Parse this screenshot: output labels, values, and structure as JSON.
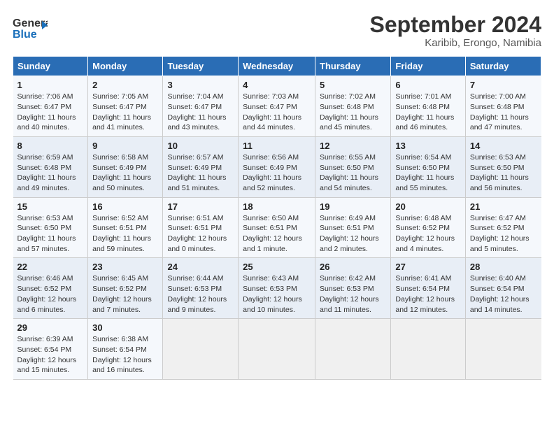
{
  "logo": {
    "line1": "General",
    "line2": "Blue",
    "icon": "▶"
  },
  "title": "September 2024",
  "subtitle": "Karibib, Erongo, Namibia",
  "days_of_week": [
    "Sunday",
    "Monday",
    "Tuesday",
    "Wednesday",
    "Thursday",
    "Friday",
    "Saturday"
  ],
  "weeks": [
    [
      {
        "day": "1",
        "info": "Sunrise: 7:06 AM\nSunset: 6:47 PM\nDaylight: 11 hours\nand 40 minutes."
      },
      {
        "day": "2",
        "info": "Sunrise: 7:05 AM\nSunset: 6:47 PM\nDaylight: 11 hours\nand 41 minutes."
      },
      {
        "day": "3",
        "info": "Sunrise: 7:04 AM\nSunset: 6:47 PM\nDaylight: 11 hours\nand 43 minutes."
      },
      {
        "day": "4",
        "info": "Sunrise: 7:03 AM\nSunset: 6:47 PM\nDaylight: 11 hours\nand 44 minutes."
      },
      {
        "day": "5",
        "info": "Sunrise: 7:02 AM\nSunset: 6:48 PM\nDaylight: 11 hours\nand 45 minutes."
      },
      {
        "day": "6",
        "info": "Sunrise: 7:01 AM\nSunset: 6:48 PM\nDaylight: 11 hours\nand 46 minutes."
      },
      {
        "day": "7",
        "info": "Sunrise: 7:00 AM\nSunset: 6:48 PM\nDaylight: 11 hours\nand 47 minutes."
      }
    ],
    [
      {
        "day": "8",
        "info": "Sunrise: 6:59 AM\nSunset: 6:48 PM\nDaylight: 11 hours\nand 49 minutes."
      },
      {
        "day": "9",
        "info": "Sunrise: 6:58 AM\nSunset: 6:49 PM\nDaylight: 11 hours\nand 50 minutes."
      },
      {
        "day": "10",
        "info": "Sunrise: 6:57 AM\nSunset: 6:49 PM\nDaylight: 11 hours\nand 51 minutes."
      },
      {
        "day": "11",
        "info": "Sunrise: 6:56 AM\nSunset: 6:49 PM\nDaylight: 11 hours\nand 52 minutes."
      },
      {
        "day": "12",
        "info": "Sunrise: 6:55 AM\nSunset: 6:50 PM\nDaylight: 11 hours\nand 54 minutes."
      },
      {
        "day": "13",
        "info": "Sunrise: 6:54 AM\nSunset: 6:50 PM\nDaylight: 11 hours\nand 55 minutes."
      },
      {
        "day": "14",
        "info": "Sunrise: 6:53 AM\nSunset: 6:50 PM\nDaylight: 11 hours\nand 56 minutes."
      }
    ],
    [
      {
        "day": "15",
        "info": "Sunrise: 6:53 AM\nSunset: 6:50 PM\nDaylight: 11 hours\nand 57 minutes."
      },
      {
        "day": "16",
        "info": "Sunrise: 6:52 AM\nSunset: 6:51 PM\nDaylight: 11 hours\nand 59 minutes."
      },
      {
        "day": "17",
        "info": "Sunrise: 6:51 AM\nSunset: 6:51 PM\nDaylight: 12 hours\nand 0 minutes."
      },
      {
        "day": "18",
        "info": "Sunrise: 6:50 AM\nSunset: 6:51 PM\nDaylight: 12 hours\nand 1 minute."
      },
      {
        "day": "19",
        "info": "Sunrise: 6:49 AM\nSunset: 6:51 PM\nDaylight: 12 hours\nand 2 minutes."
      },
      {
        "day": "20",
        "info": "Sunrise: 6:48 AM\nSunset: 6:52 PM\nDaylight: 12 hours\nand 4 minutes."
      },
      {
        "day": "21",
        "info": "Sunrise: 6:47 AM\nSunset: 6:52 PM\nDaylight: 12 hours\nand 5 minutes."
      }
    ],
    [
      {
        "day": "22",
        "info": "Sunrise: 6:46 AM\nSunset: 6:52 PM\nDaylight: 12 hours\nand 6 minutes."
      },
      {
        "day": "23",
        "info": "Sunrise: 6:45 AM\nSunset: 6:52 PM\nDaylight: 12 hours\nand 7 minutes."
      },
      {
        "day": "24",
        "info": "Sunrise: 6:44 AM\nSunset: 6:53 PM\nDaylight: 12 hours\nand 9 minutes."
      },
      {
        "day": "25",
        "info": "Sunrise: 6:43 AM\nSunset: 6:53 PM\nDaylight: 12 hours\nand 10 minutes."
      },
      {
        "day": "26",
        "info": "Sunrise: 6:42 AM\nSunset: 6:53 PM\nDaylight: 12 hours\nand 11 minutes."
      },
      {
        "day": "27",
        "info": "Sunrise: 6:41 AM\nSunset: 6:54 PM\nDaylight: 12 hours\nand 12 minutes."
      },
      {
        "day": "28",
        "info": "Sunrise: 6:40 AM\nSunset: 6:54 PM\nDaylight: 12 hours\nand 14 minutes."
      }
    ],
    [
      {
        "day": "29",
        "info": "Sunrise: 6:39 AM\nSunset: 6:54 PM\nDaylight: 12 hours\nand 15 minutes."
      },
      {
        "day": "30",
        "info": "Sunrise: 6:38 AM\nSunset: 6:54 PM\nDaylight: 12 hours\nand 16 minutes."
      },
      null,
      null,
      null,
      null,
      null
    ]
  ]
}
